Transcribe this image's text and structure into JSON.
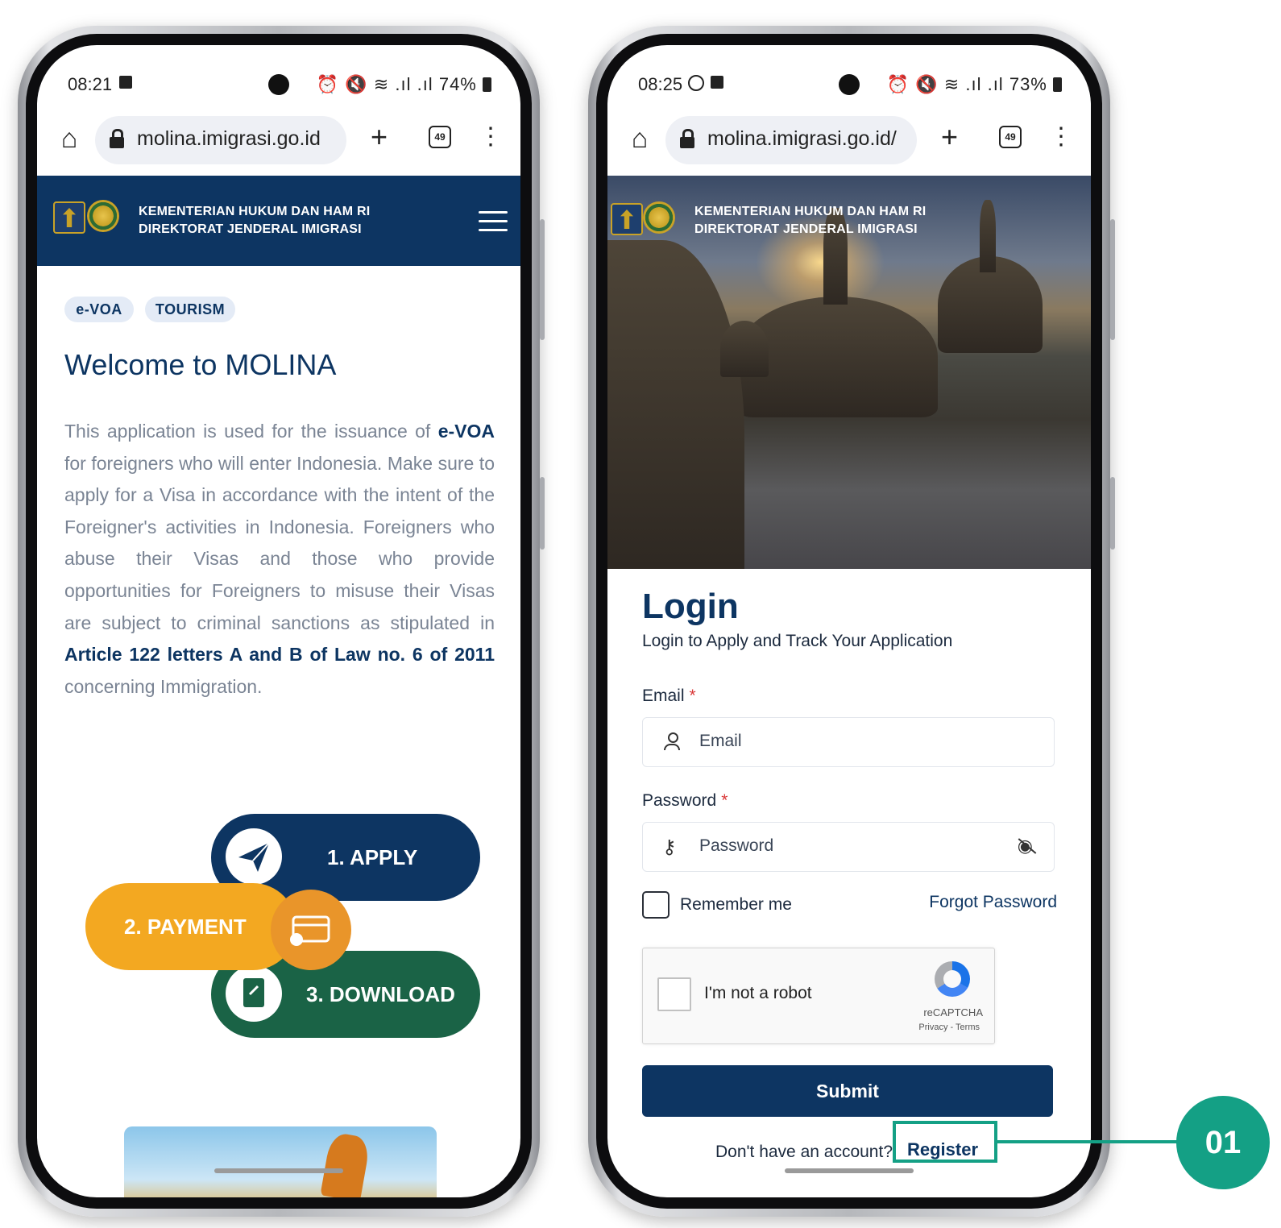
{
  "phone_left": {
    "status": {
      "time": "08:21",
      "right_icons": "⏰ 🔇 ≋ .ıl .ıl",
      "battery": "74%"
    },
    "browser": {
      "url": "molina.imigrasi.go.id",
      "tab_count": "49"
    },
    "header": {
      "line1": "KEMENTERIAN HUKUM DAN HAM RI",
      "line2": "DIREKTORAT JENDERAL IMIGRASI"
    },
    "tags": [
      "e-VOA",
      "TOURISM"
    ],
    "welcome": "Welcome to MOLINA",
    "paragraph": {
      "p1": "This application is used for the issuance of ",
      "b1": "e-VOA",
      "p2": " for foreigners who will enter Indonesia. Make sure to apply for a Visa in accordance with the intent of the Foreigner's activities in Indonesia. Foreigners who abuse their Visas and those who provide opportunities for Foreigners to misuse their Visas are subject to criminal sanctions as stipulated in ",
      "b2": "Article 122 letters A and B of Law no. 6 of 2011",
      "p3": " concerning Immigration."
    },
    "steps": {
      "apply": "1. APPLY",
      "payment": "2. PAYMENT",
      "download": "3. DOWNLOAD"
    }
  },
  "phone_right": {
    "status": {
      "time": "08:25",
      "right_icons": "⏰ 🔇 ≋ .ıl .ıl",
      "battery": "73%"
    },
    "browser": {
      "url": "molina.imigrasi.go.id/",
      "tab_count": "49"
    },
    "header": {
      "line1": "KEMENTERIAN HUKUM DAN HAM RI",
      "line2": "DIREKTORAT JENDERAL IMIGRASI"
    },
    "login": {
      "title": "Login",
      "subtitle": "Login to Apply and Track Your Application",
      "email_label": "Email",
      "email_placeholder": "Email",
      "password_label": "Password",
      "password_placeholder": "Password",
      "required_mark": "*",
      "remember_me": "Remember me",
      "forgot_password": "Forgot Password",
      "captcha_label": "I'm not a robot",
      "captcha_brand": "reCAPTCHA",
      "captcha_terms": "Privacy - Terms",
      "submit": "Submit",
      "no_account": "Don't have an account?",
      "register": "Register"
    }
  },
  "callout": {
    "number": "01",
    "color": "#14a085"
  },
  "colors": {
    "primary": "#0d3562",
    "payment": "#f3a821",
    "download": "#1a6346"
  }
}
